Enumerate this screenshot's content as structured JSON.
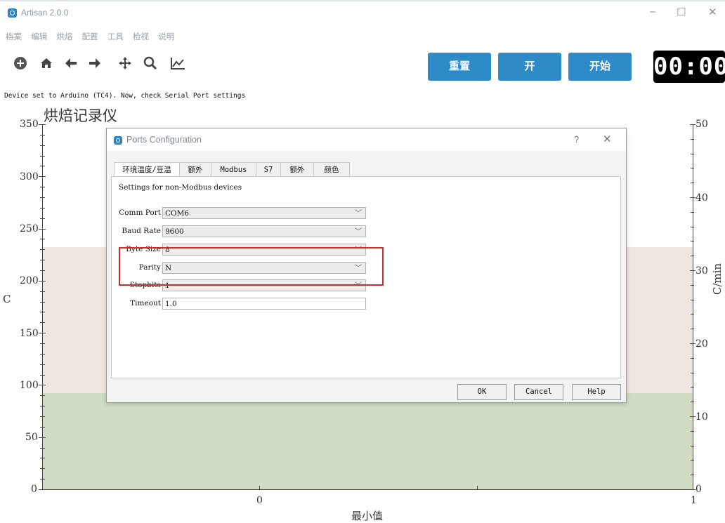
{
  "window": {
    "title": "Artisan 2.0.0",
    "minimize": "–",
    "maximize": "☐",
    "close": "✕"
  },
  "menu": [
    "档案",
    "编辑",
    "烘焙",
    "配置",
    "工具",
    "检视",
    "说明"
  ],
  "toolbar": {
    "icons": [
      "plus-circle-icon",
      "home-icon",
      "arrow-left-icon",
      "arrow-right-icon",
      "move-icon",
      "zoom-icon",
      "chart-icon"
    ],
    "reset_label": "重置",
    "on_label": "开",
    "start_label": "开始",
    "timer": "00:00",
    "colors": {
      "button": "#2f8ac8",
      "lcd": "#000000"
    }
  },
  "status_message": "Device set to Arduino (TC4). Now, check Serial Port settings",
  "chart": {
    "title": "烘焙记录仪",
    "y_left_label": "C",
    "y_right_label": "C/min",
    "x_label": "最小值",
    "y_left_ticks": [
      "350",
      "300",
      "250",
      "200",
      "150",
      "100",
      "50",
      "0"
    ],
    "y_right_ticks": [
      "50",
      "40",
      "30",
      "20",
      "10",
      "0"
    ],
    "x_ticks": [
      "0",
      "1"
    ],
    "colors": {
      "upper_band": "#efe6e1",
      "lower_band": "#d1dcc4"
    }
  },
  "dialog": {
    "title": "Ports Configuration",
    "help": "?",
    "close": "✕",
    "tabs": [
      "环境温度/豆温",
      "额外",
      "Modbus",
      "S7",
      "额外",
      "颜色"
    ],
    "active_tab": 0,
    "description": "Settings for non-Modbus devices",
    "fields": [
      {
        "label": "Comm Port",
        "value": "COM6"
      },
      {
        "label": "Baud Rate",
        "value": "9600"
      },
      {
        "label": "Byte Size",
        "value": "8"
      },
      {
        "label": "Parity",
        "value": "N"
      },
      {
        "label": "Stopbits",
        "value": "1"
      },
      {
        "label": "Timeout",
        "value": "1.0"
      }
    ],
    "buttons": {
      "ok": "OK",
      "cancel": "Cancel",
      "help": "Help"
    },
    "highlight_color": "#d42a2a"
  }
}
